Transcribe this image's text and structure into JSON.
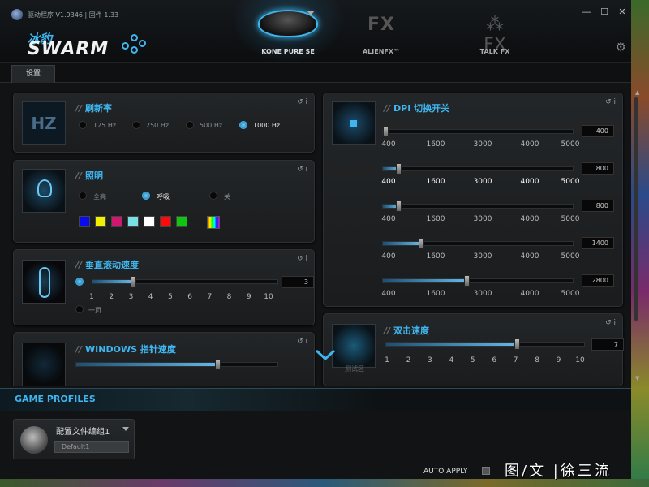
{
  "app": {
    "version": "驱动程序 V1.9346 | 固件 1.33"
  },
  "brand": {
    "cn": "冰豹",
    "en": "SWARM"
  },
  "top_tabs": [
    {
      "label": "KONE PURE SE",
      "active": true
    },
    {
      "label": "ALIENFX™",
      "icon_text": "FX"
    },
    {
      "label": "TALK FX",
      "icon_text": "FX"
    }
  ],
  "window_controls": {
    "close": "✕",
    "minimize": "—",
    "maximize": "☐"
  },
  "settings_tab": "设置",
  "panels": {
    "polling": {
      "title": "刷新率",
      "img_text": "HZ",
      "options": [
        "125 Hz",
        "250 Hz",
        "500 Hz",
        "1000 Hz"
      ],
      "selected": "1000 Hz"
    },
    "lighting": {
      "title": "照明",
      "options": [
        "全亮",
        "呼吸",
        "关"
      ],
      "selected": "呼吸",
      "swatches": [
        "#0a0aee",
        "#f0f000",
        "#d01870",
        "#79e0e6",
        "#ffffff",
        "#ff0a0a",
        "#10c410"
      ]
    },
    "scroll": {
      "title": "垂直滚动速度",
      "value": "3",
      "ticks": [
        "1",
        "2",
        "3",
        "4",
        "5",
        "6",
        "7",
        "8",
        "9",
        "10"
      ],
      "option_page": "一页",
      "fraction": 0.22
    },
    "windows_speed": {
      "title": "WINDOWS 指针速度",
      "fraction": 0.7
    },
    "dpi": {
      "title": "DPI 切换开关",
      "ticks": [
        "400",
        "1600",
        "3000",
        "4000",
        "5000"
      ],
      "levels": [
        {
          "value": "400",
          "fraction": 0.0
        },
        {
          "value": "800",
          "fraction": 0.08
        },
        {
          "value": "800",
          "fraction": 0.08
        },
        {
          "value": "1400",
          "fraction": 0.2
        },
        {
          "value": "2800",
          "fraction": 0.44
        }
      ]
    },
    "double_click": {
      "title": "双击速度",
      "value": "7",
      "ticks": [
        "1",
        "2",
        "3",
        "4",
        "5",
        "6",
        "7",
        "8",
        "9",
        "10"
      ],
      "img_caption": "测试区",
      "fraction": 0.66
    }
  },
  "profiles": {
    "title": "GAME PROFILES",
    "name": "配置文件编组1",
    "default": "Default1",
    "auto_apply": "AUTO APPLY"
  },
  "watermark": "图/文 |徐三流"
}
